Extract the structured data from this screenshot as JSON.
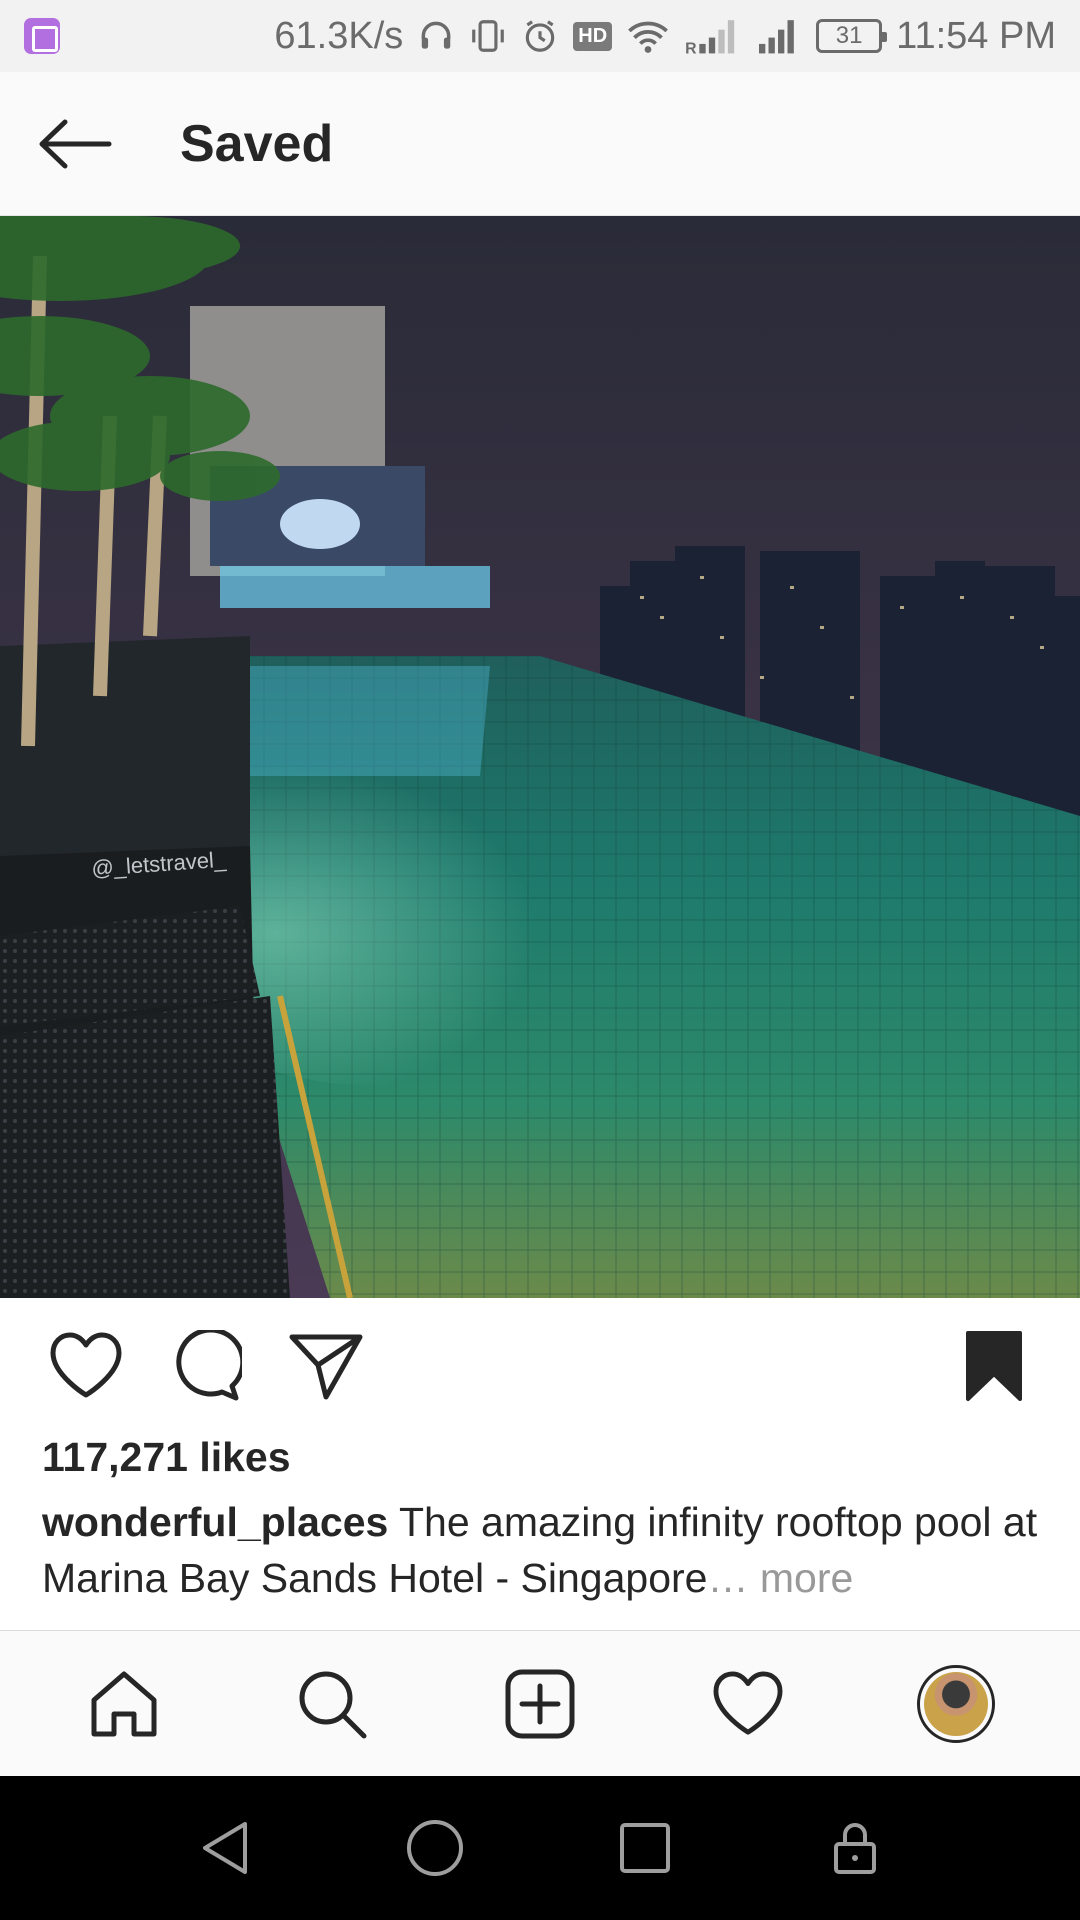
{
  "status_bar": {
    "network_speed": "61.3K/s",
    "hd_label": "HD",
    "battery_level": "31",
    "time": "11:54 PM"
  },
  "header": {
    "title": "Saved"
  },
  "post": {
    "image_watermark": "@_letstravel_",
    "likes": "117,271 likes",
    "username": "wonderful_places",
    "caption": " The amazing infinity rooftop pool at  Marina Bay Sands Hotel - Singapore",
    "ellipsis": "…",
    "more_label": " more",
    "saved": true
  },
  "bottom_nav": {
    "items": [
      "home-icon",
      "search-icon",
      "new-post-icon",
      "activity-icon",
      "profile-avatar"
    ]
  },
  "system_nav": {
    "items": [
      "back-icon",
      "home-circle-icon",
      "recents-icon",
      "lock-icon"
    ]
  }
}
